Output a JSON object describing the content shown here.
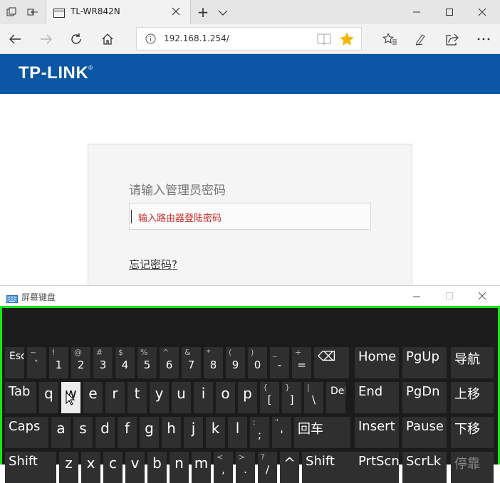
{
  "browser": {
    "tab_title": "TL-WR842N",
    "new_tab_symbol": "+",
    "url": "192.168.1.254/"
  },
  "page": {
    "logo_text": "TP-LINK",
    "logo_mark": "®",
    "login_prompt": "请输入管理员密码",
    "password_placeholder": "输入路由器登陆密码",
    "forgot_link": "忘记密码?"
  },
  "osk": {
    "title": "屏幕键盘",
    "accent_color": "#17e617",
    "rows": [
      [
        {
          "label": "Esc",
          "small": true
        },
        {
          "label": "`",
          "shift": "~"
        },
        {
          "label": "1",
          "shift": "!"
        },
        {
          "label": "2",
          "shift": "@"
        },
        {
          "label": "3",
          "shift": "#"
        },
        {
          "label": "4",
          "shift": "$"
        },
        {
          "label": "5",
          "shift": "%"
        },
        {
          "label": "6",
          "shift": "^"
        },
        {
          "label": "7",
          "shift": "&"
        },
        {
          "label": "8",
          "shift": "*"
        },
        {
          "label": "9",
          "shift": "("
        },
        {
          "label": "0",
          "shift": ")"
        },
        {
          "label": "-",
          "shift": "_"
        },
        {
          "label": "=",
          "shift": "+"
        },
        {
          "label": "⌫",
          "wide": true
        }
      ],
      [
        {
          "label": "Tab",
          "wide": true
        },
        {
          "label": "q"
        },
        {
          "label": "w",
          "highlight": true
        },
        {
          "label": "e"
        },
        {
          "label": "r"
        },
        {
          "label": "t"
        },
        {
          "label": "y"
        },
        {
          "label": "u"
        },
        {
          "label": "i"
        },
        {
          "label": "o"
        },
        {
          "label": "p"
        },
        {
          "label": "[",
          "shift": "{"
        },
        {
          "label": "]",
          "shift": "}"
        },
        {
          "label": "\\",
          "shift": "|"
        },
        {
          "label": "Del",
          "small": true
        }
      ],
      [
        {
          "label": "Caps",
          "wide": true
        },
        {
          "label": "a"
        },
        {
          "label": "s"
        },
        {
          "label": "d"
        },
        {
          "label": "f"
        },
        {
          "label": "g"
        },
        {
          "label": "h"
        },
        {
          "label": "j"
        },
        {
          "label": "k"
        },
        {
          "label": "l"
        },
        {
          "label": ";",
          "shift": ":"
        },
        {
          "label": "'",
          "shift": "\""
        },
        {
          "label": "回车",
          "wide": true
        }
      ],
      [
        {
          "label": "Shift",
          "wide": true
        },
        {
          "label": "z"
        },
        {
          "label": "x"
        },
        {
          "label": "c"
        },
        {
          "label": "v"
        },
        {
          "label": "b"
        },
        {
          "label": "n"
        },
        {
          "label": "m"
        },
        {
          "label": ",",
          "shift": "<"
        },
        {
          "label": ".",
          "shift": ">"
        },
        {
          "label": "/",
          "shift": "?"
        },
        {
          "label": "^"
        },
        {
          "label": "Shift",
          "wide": true
        }
      ]
    ],
    "nav_keys": [
      [
        "Home",
        "PgUp",
        "导航"
      ],
      [
        "End",
        "PgDn",
        "上移"
      ],
      [
        "Insert",
        "Pause",
        "下移"
      ],
      [
        "PrtScn",
        "ScrLk",
        "停靠"
      ]
    ]
  }
}
